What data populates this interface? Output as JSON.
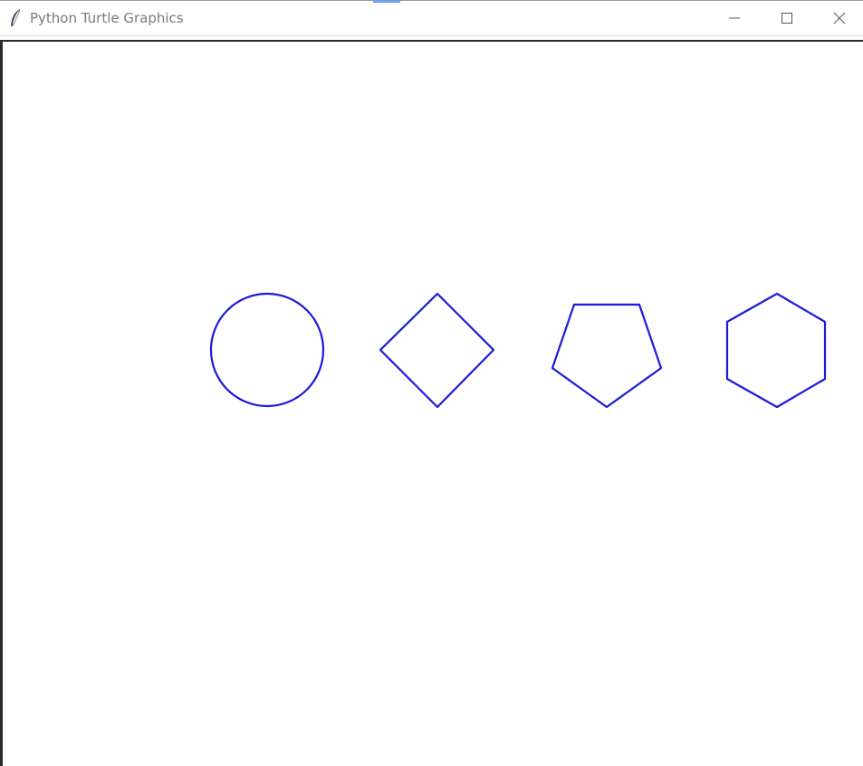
{
  "window": {
    "title": "Python Turtle Graphics"
  },
  "controls": {
    "minimize": "minimize-icon",
    "maximize": "maximize-icon",
    "close": "close-icon"
  },
  "canvas": {
    "shapes": [
      "circle",
      "square",
      "pentagon",
      "hexagon"
    ],
    "pen_color": "#1a1adb"
  },
  "colors": {
    "title_text": "#7a7a7a",
    "background": "#ffffff"
  }
}
